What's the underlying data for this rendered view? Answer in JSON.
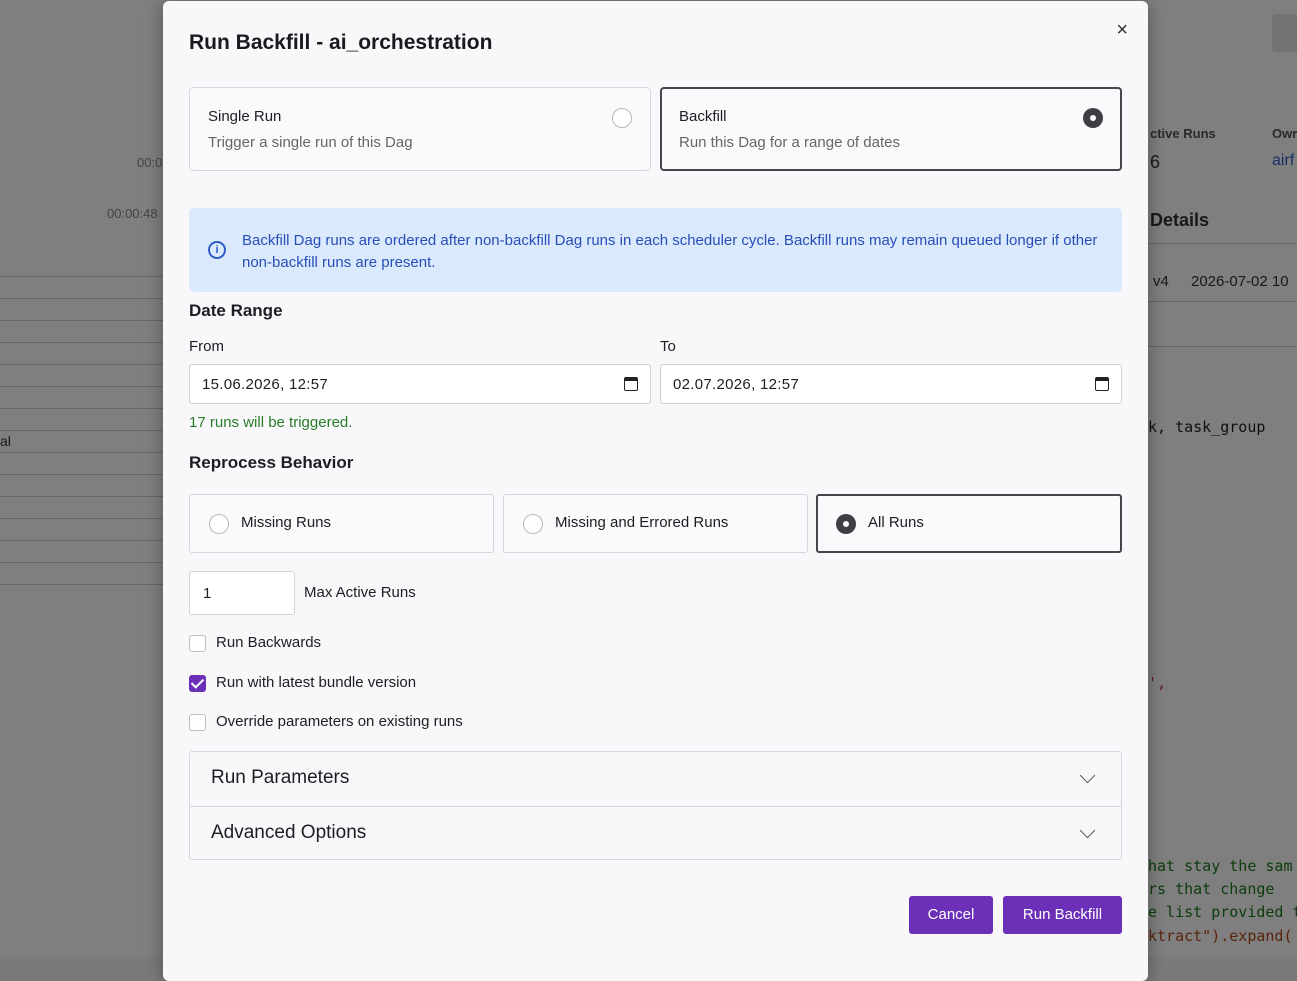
{
  "background": {
    "times": [
      "00:0",
      "00:00:48"
    ],
    "stat_label": "ctive Runs",
    "stat_value": "6",
    "owner_label": "Owr",
    "owner_value": "airf",
    "details_heading": "Details",
    "version_label": "v4",
    "version_date": "2026-07-02 10",
    "row_text": "al",
    "code_line_1": "k, task_group",
    "code_line_2": "',",
    "code_comment_1": "hat stay the sam",
    "code_comment_2": "rs that change",
    "code_comment_3": "e list provided t",
    "code_line_3": "ktract\").expand("
  },
  "modal": {
    "title": "Run Backfill - ai_orchestration",
    "close_label": "×",
    "mode_options": [
      {
        "title": "Single Run",
        "desc": "Trigger a single run of this Dag",
        "selected": false
      },
      {
        "title": "Backfill",
        "desc": "Run this Dag for a range of dates",
        "selected": true
      }
    ],
    "info_message": "Backfill Dag runs are ordered after non-backfill Dag runs in each scheduler cycle. Backfill runs may remain queued longer if other non-backfill runs are present.",
    "info_icon": "info-icon",
    "date_range": {
      "heading": "Date Range",
      "from_label": "From",
      "from_value": "15.06.2026, 12:57",
      "to_label": "To",
      "to_value": "02.07.2026, 12:57"
    },
    "runs_notice": "17 runs will be triggered.",
    "reprocess": {
      "heading": "Reprocess Behavior",
      "options": [
        {
          "label": "Missing Runs",
          "selected": false
        },
        {
          "label": "Missing and Errored Runs",
          "selected": true
        },
        {
          "label": "All Runs",
          "selected": true
        }
      ]
    },
    "max_active_runs": {
      "value": "1",
      "label": "Max Active Runs"
    },
    "checkboxes": [
      {
        "label": "Run Backwards",
        "checked": false
      },
      {
        "label": "Run with latest bundle version",
        "checked": true
      },
      {
        "label": "Override parameters on existing runs",
        "checked": false
      }
    ],
    "accordion": [
      {
        "label": "Run Parameters"
      },
      {
        "label": "Advanced Options"
      }
    ],
    "buttons": {
      "cancel": "Cancel",
      "submit": "Run Backfill"
    },
    "accent_color": "#6b2fb8"
  }
}
